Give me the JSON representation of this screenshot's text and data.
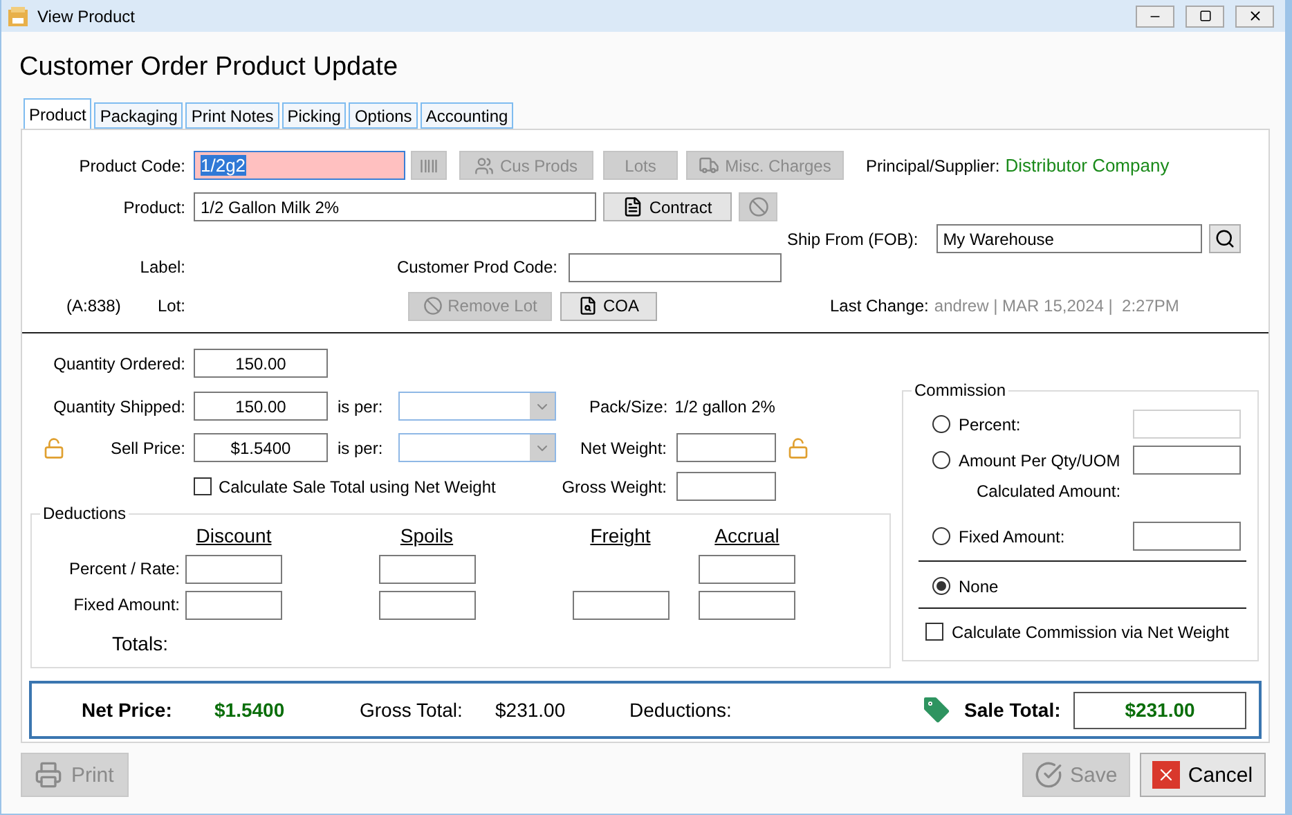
{
  "window": {
    "title": "View Product"
  },
  "heading": "Customer Order Product Update",
  "tabs": [
    {
      "label": "Product",
      "selected": true
    },
    {
      "label": "Packaging",
      "selected": false
    },
    {
      "label": "Print Notes",
      "selected": false
    },
    {
      "label": "Picking",
      "selected": false
    },
    {
      "label": "Options",
      "selected": false
    },
    {
      "label": "Accounting",
      "selected": false
    }
  ],
  "product_code": {
    "label": "Product Code:",
    "value": "1/2g2",
    "invalid": true
  },
  "code_buttons": [
    {
      "disabled": true
    },
    {
      "label": "Cus Prods",
      "disabled": true
    },
    {
      "label": "Lots",
      "disabled": true
    },
    {
      "label": "Misc. Charges",
      "disabled": true
    }
  ],
  "supplier": {
    "label": "Principal/Supplier:",
    "value": "Distributor Company"
  },
  "product": {
    "label": "Product:",
    "value": "1/2 Gallon Milk 2%"
  },
  "contract": {
    "label": "Contract",
    "disabled": false
  },
  "clear_button": {
    "disabled": true
  },
  "ship_from": {
    "label": "Ship From (FOB):",
    "value": "My Warehouse"
  },
  "label_field": {
    "label": "Label:"
  },
  "customer_prod_code": {
    "label": "Customer Prod Code:"
  },
  "lot": {
    "count": "(A:838)",
    "label": "Lot:"
  },
  "remove_lot": {
    "label": "Remove Lot",
    "disabled": true
  },
  "coa": {
    "label": "COA",
    "disabled": false
  },
  "last_change": {
    "label": "Last Change:",
    "value": "andrew | MAR 15,2024 |  2:27PM"
  },
  "quantity_ordered": {
    "label": "Quantity Ordered:",
    "value": "150.00"
  },
  "quantity_shipped": {
    "label": "Quantity Shipped:",
    "value": "150.00",
    "per_label": "is per:"
  },
  "pack_size": {
    "label": "Pack/Size:",
    "value": "1/2 gallon 2%"
  },
  "sell_price": {
    "label": "Sell Price:",
    "value": "$1.5400",
    "per_label": "is per:"
  },
  "net_weight": {
    "label": "Net Weight:"
  },
  "gross_weight": {
    "label": "Gross Weight:"
  },
  "net_weight_total": {
    "label": "Calculate Sale Total using Net Weight",
    "checked": false
  },
  "deductions": {
    "title": "Deductions",
    "columns": [
      "Discount",
      "Spoils",
      "Freight",
      "Accrual"
    ],
    "rows": [
      {
        "label": "Percent / Rate:",
        "cells": [
          {
            "kind": "field"
          },
          {
            "kind": "field"
          },
          {
            "kind": "blank"
          },
          {
            "kind": "field"
          }
        ]
      },
      {
        "label": "Fixed Amount:",
        "cells": [
          {
            "kind": "field"
          },
          {
            "kind": "field"
          },
          {
            "kind": "field"
          },
          {
            "kind": "field"
          }
        ]
      }
    ],
    "totals_label": "Totals:"
  },
  "commission": {
    "title": "Commission",
    "options": [
      {
        "kind": "with_field",
        "label": "Percent:",
        "selected": false,
        "field_disabled": true
      },
      {
        "kind": "with_field",
        "label": "Amount Per Qty/UOM",
        "selected": false,
        "field_disabled": false
      },
      {
        "kind": "with_field",
        "label": "Fixed Amount:",
        "selected": false,
        "field_disabled": false
      },
      {
        "kind": "plain",
        "label": "None",
        "selected": true
      }
    ],
    "calculated_label": "Calculated Amount:",
    "net_weight": {
      "label": "Calculate Commission via Net Weight",
      "checked": false
    }
  },
  "summary": {
    "net_price": {
      "label": "Net Price:",
      "value": "$1.5400"
    },
    "gross_total": {
      "label": "Gross Total:",
      "value": "$231.00"
    },
    "deductions": {
      "label": "Deductions:"
    },
    "sale_total": {
      "label": "Sale Total:",
      "value": "$231.00"
    }
  },
  "footer": {
    "print": {
      "label": "Print",
      "disabled": true
    },
    "save": {
      "label": "Save",
      "disabled": true
    },
    "cancel": {
      "label": "Cancel",
      "disabled": false
    }
  }
}
